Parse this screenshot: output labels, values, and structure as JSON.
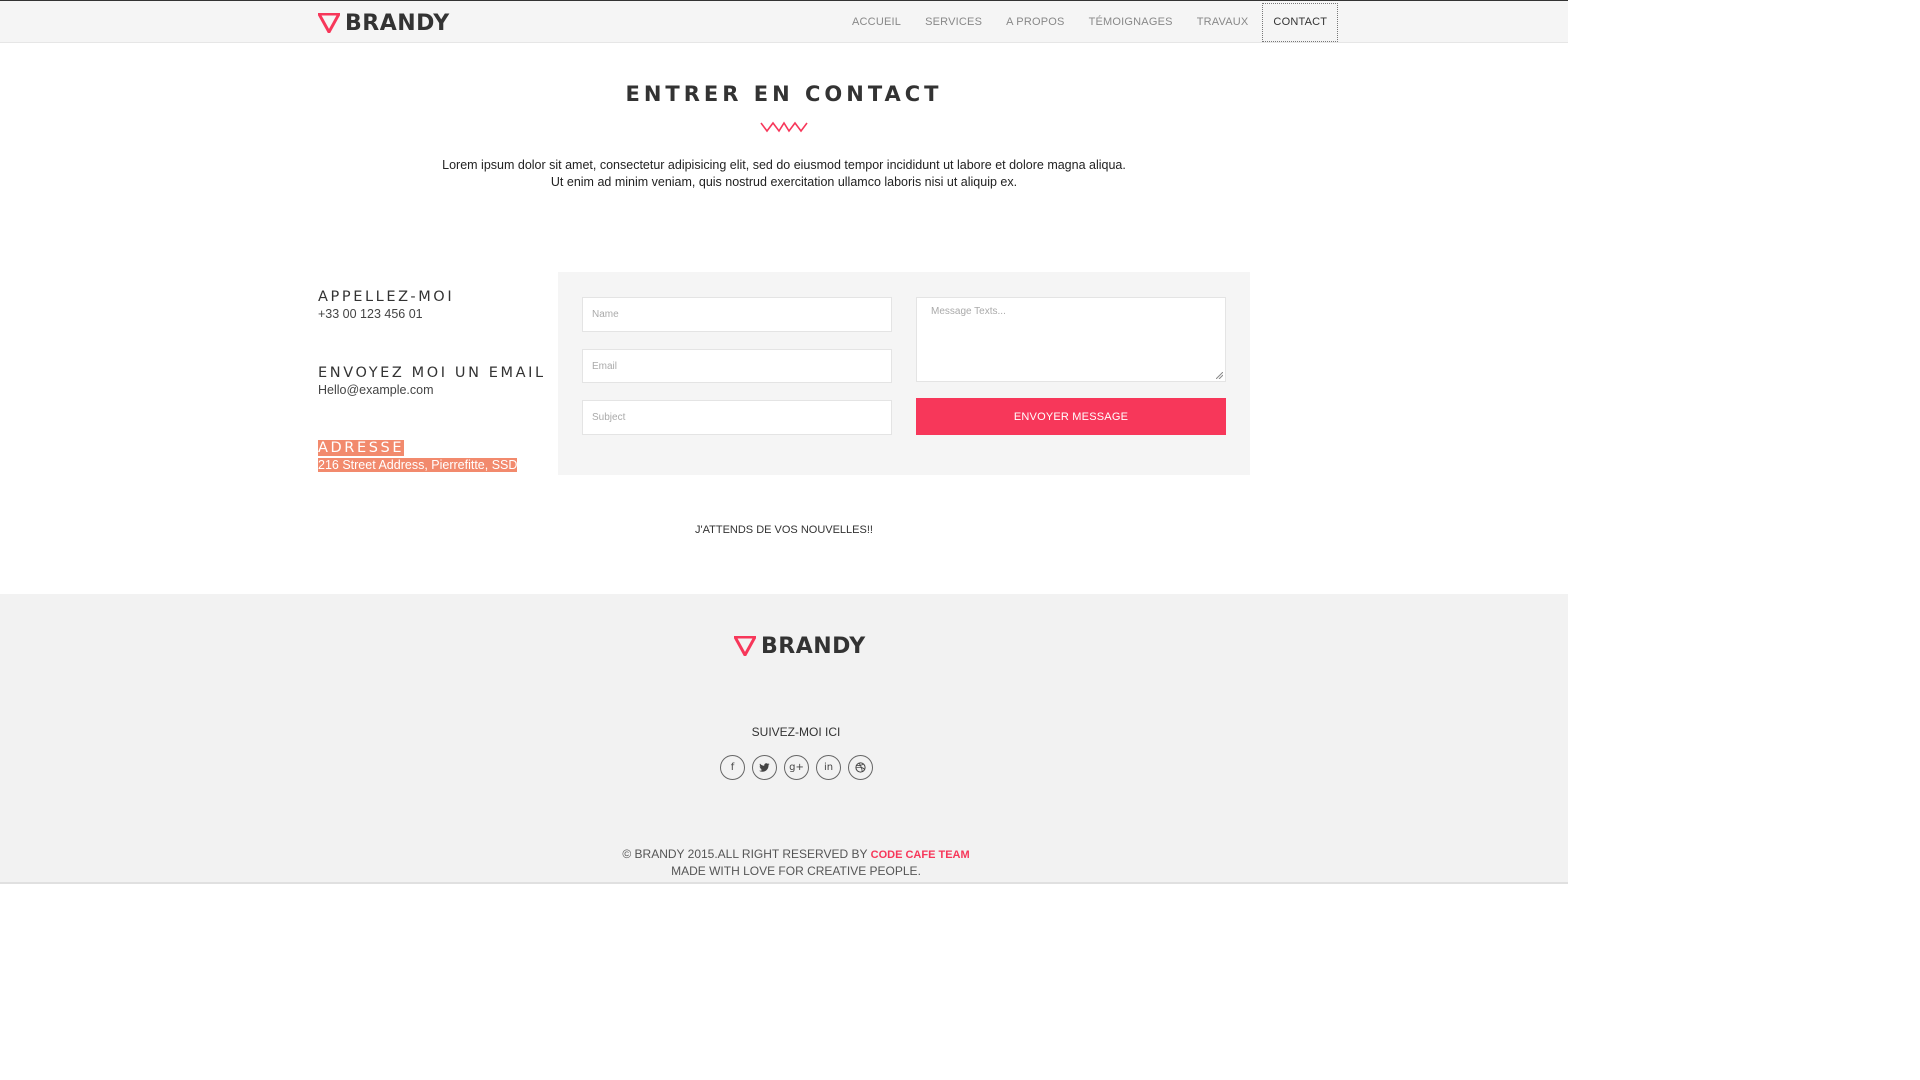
{
  "brand": {
    "name": "BRANDY",
    "accent": "#f7375a"
  },
  "nav": {
    "items": [
      "ACCUEIL",
      "SERVICES",
      "A PROPOS",
      "TÉMOIGNAGES",
      "TRAVAUX",
      "CONTACT"
    ],
    "active": "CONTACT"
  },
  "hero": {
    "title": "ENTRER EN CONTACT",
    "lead": "Lorem ipsum dolor sit amet, consectetur adipisicing elit, sed do eiusmod tempor incididunt ut labore et dolore magna aliqua. Ut enim ad minim veniam, quis nostrud exercitation ullamco laboris nisi ut aliquip ex."
  },
  "contact": {
    "call_heading": "APPELLEZ-MOI",
    "phone": "+33 00 123 456 01",
    "mail_heading": "ENVOYEZ MOI UN EMAIL",
    "email": "Hello@example.com",
    "address_heading": "ADRESSE",
    "address": "216 Street Address, Pierrefitte, SSD"
  },
  "form": {
    "name_placeholder": "Name",
    "email_placeholder": "Email",
    "subject_placeholder": "Subject",
    "message_placeholder": "Message Texts...",
    "submit_label": "ENVOYER MESSAGE"
  },
  "await_text": "J'ATTENDS DE VOS NOUVELLES!!",
  "footer": {
    "brand": "BRANDY",
    "follow_label": "SUIVEZ-MOI ICI",
    "socials": [
      "facebook-icon",
      "twitter-icon",
      "google-plus-icon",
      "linkedin-icon",
      "dribbble-icon"
    ],
    "copyright": "© BRANDY 2015.ALL RIGHT RESERVED BY",
    "team": "CODE CAFE TEAM",
    "tagline": "MADE WITH LOVE FOR CREATIVE PEOPLE."
  }
}
